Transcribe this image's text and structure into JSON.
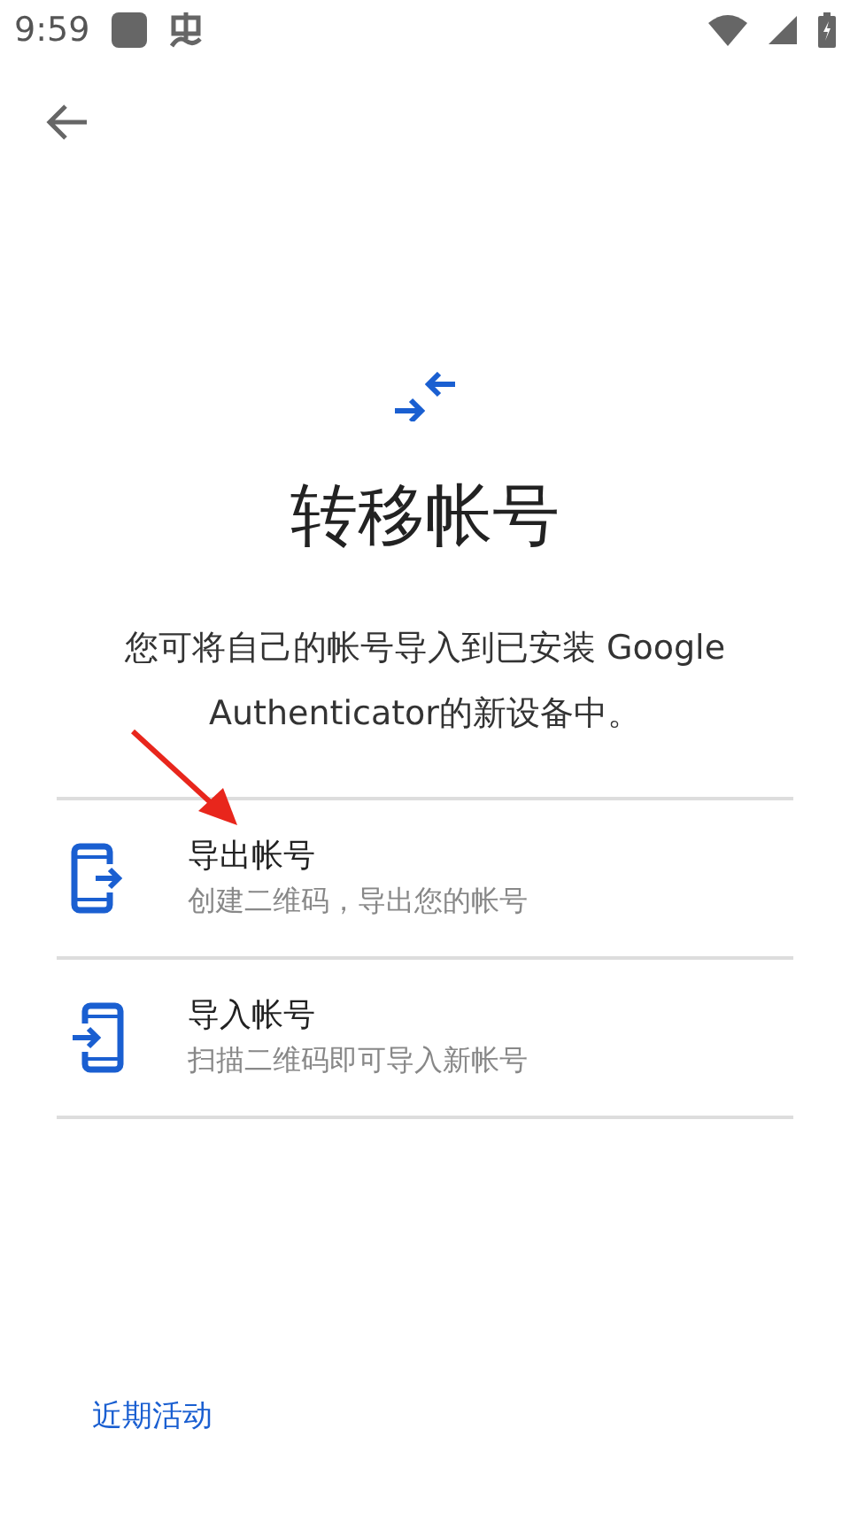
{
  "status_bar": {
    "time": "9:59"
  },
  "title": "转移帐号",
  "description": "您可将自己的帐号导入到已安装 Google Authenticator的新设备中。",
  "options": [
    {
      "kind": "export",
      "title": "导出帐号",
      "subtitle": "创建二维码，导出您的帐号"
    },
    {
      "kind": "import",
      "title": "导入帐号",
      "subtitle": "扫描二维码即可导入新帐号"
    }
  ],
  "footer_link": "近期活动"
}
